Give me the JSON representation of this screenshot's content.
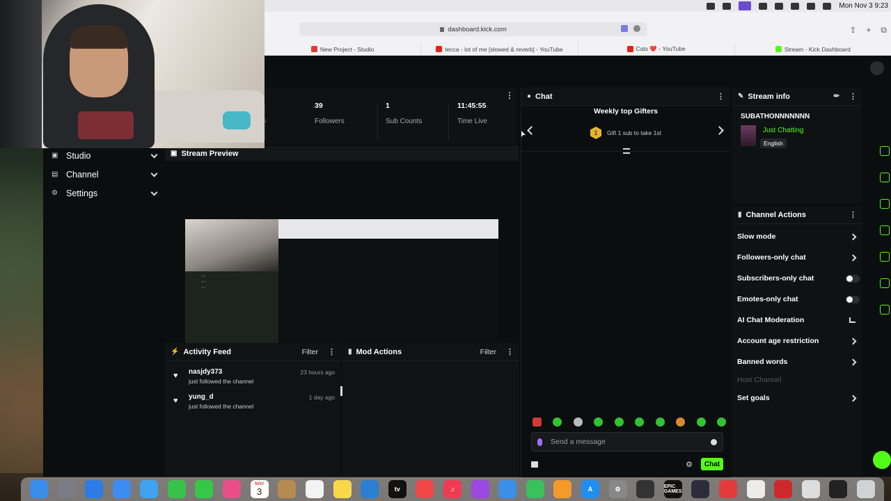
{
  "menubar": {
    "clock": "Mon Nov 3  9:23"
  },
  "browser": {
    "url": "dashboard.kick.com",
    "tabs": [
      {
        "label": "New Project - Studio",
        "icon": "record-icon",
        "color": "#e63b3b"
      },
      {
        "label": "tecca - lot of me [slowed & reverb] - YouTube",
        "icon": "youtube-icon",
        "color": "#e62117"
      },
      {
        "label": "Cats ❤️ - YouTube",
        "icon": "youtube-icon",
        "color": "#e62117"
      },
      {
        "label": "Stream - Kick Dashboard",
        "icon": "kick-icon",
        "color": "#53fc18"
      }
    ]
  },
  "sidebar": {
    "items": [
      {
        "label": "Studio",
        "icon": "studio-icon"
      },
      {
        "label": "Channel",
        "icon": "channel-icon"
      },
      {
        "label": "Settings",
        "icon": "gear-icon"
      }
    ]
  },
  "stats": {
    "partial_label": "rs",
    "followers": {
      "value": "39",
      "label": "Followers"
    },
    "subs": {
      "value": "1",
      "label": "Sub Counts"
    },
    "time": {
      "value": "11:45:55",
      "label": "Time Live"
    }
  },
  "preview": {
    "title": "Stream Preview"
  },
  "activity": {
    "title": "Activity Feed",
    "filter": "Filter",
    "items": [
      {
        "user": "nasjdy373",
        "desc": "just followed the channel",
        "time": "23 hours ago"
      },
      {
        "user": "yung_d",
        "desc": "just followed the channel",
        "time": "1 day ago"
      }
    ]
  },
  "mod": {
    "title": "Mod Actions",
    "filter": "Filter"
  },
  "chat": {
    "title": "Chat",
    "gifters_title": "Weekly top Gifters",
    "gift_rank": "1",
    "gift_text": "Gift 1 sub to take 1st",
    "placeholder": "Send a message",
    "send_label": "Chat"
  },
  "stream_info": {
    "title": "Stream info",
    "stream_title": "SUBATHONNNNNNN",
    "category": "Just Chatting",
    "language": "English"
  },
  "channel_actions": {
    "title": "Channel Actions",
    "items": [
      {
        "label": "Slow mode",
        "control": "chevron"
      },
      {
        "label": "Followers-only chat",
        "control": "chevron"
      },
      {
        "label": "Subscribers-only chat",
        "control": "toggle",
        "on": false
      },
      {
        "label": "Emotes-only chat",
        "control": "toggle",
        "on": false
      },
      {
        "label": "AI Chat Moderation",
        "control": "chart"
      },
      {
        "label": "Account age restriction",
        "control": "chevron"
      },
      {
        "label": "Banned words",
        "control": "chevron"
      },
      {
        "label": "Host Channel",
        "control": "none",
        "disabled": true
      },
      {
        "label": "Set goals",
        "control": "chevron"
      }
    ]
  },
  "dock": {
    "calendar_day": "3",
    "calendar_month": "NOV",
    "epic_label": "EPIC GAMES"
  },
  "colors": {
    "kick_green": "#53fc18",
    "panel_bg": "#101314",
    "app_bg": "#0b0e0f"
  }
}
